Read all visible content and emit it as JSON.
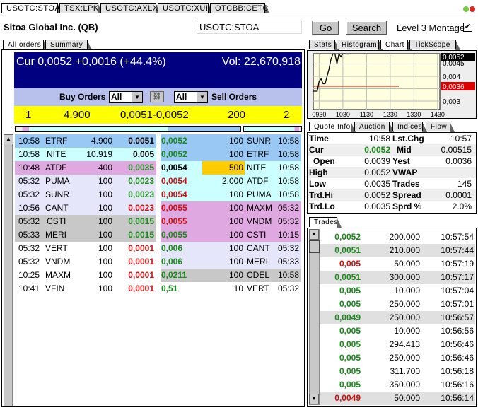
{
  "tabs": [
    "USOTC:STOA",
    "TSX:LPK",
    "USOTC:AXLX",
    "USOTC:XUII",
    "OTCBB:CETC"
  ],
  "company": "Sitoa Global Inc. (QB)",
  "symbol_input": "USOTC:STOA",
  "go_label": "Go",
  "search_label": "Search",
  "level3_label": "Level 3 Montage",
  "level3_checked": true,
  "left_tabs": [
    "All orders",
    "Summary"
  ],
  "summary": {
    "cur": "Cur 0,0052 +0,0016 (+44.4%)",
    "vol": "Vol: 22,670,918"
  },
  "filters": {
    "buy_label": "Buy Orders",
    "buy_value": "All",
    "sell_value": "All",
    "sell_label": "Sell Orders"
  },
  "inside": {
    "bid_count": "1",
    "bid_size": "4.900",
    "spread": "0,0051-0,0052",
    "ask_size": "200",
    "ask_count": "2"
  },
  "bids": [
    {
      "time": "10:58",
      "mm": "ETRF",
      "size": "4.900",
      "price": "0,0051",
      "c": "k",
      "bg": "#99c8f4"
    },
    {
      "time": "10:58",
      "mm": "NITE",
      "size": "10.919",
      "price": "0,005",
      "c": "k",
      "bg": "#ccffff"
    },
    {
      "time": "10:48",
      "mm": "ATDF",
      "size": "400",
      "price": "0,0035",
      "c": "g",
      "bg": "#e0a8e0"
    },
    {
      "time": "05:32",
      "mm": "PUMA",
      "size": "100",
      "price": "0,0023",
      "c": "g",
      "bg": "#e6e6fa"
    },
    {
      "time": "05:32",
      "mm": "SUNR",
      "size": "100",
      "price": "0,0023",
      "c": "g",
      "bg": "#e6e6fa"
    },
    {
      "time": "10:56",
      "mm": "CANT",
      "size": "100",
      "price": "0,0023",
      "c": "r",
      "bg": "#e6e6fa"
    },
    {
      "time": "05:32",
      "mm": "CSTI",
      "size": "100",
      "price": "0,0015",
      "c": "g",
      "bg": "#c8c8c8"
    },
    {
      "time": "05:33",
      "mm": "MERI",
      "size": "100",
      "price": "0,0015",
      "c": "g",
      "bg": "#c8c8c8"
    },
    {
      "time": "05:32",
      "mm": "VERT",
      "size": "100",
      "price": "0,0001",
      "c": "r",
      "bg": "#ffffff"
    },
    {
      "time": "05:32",
      "mm": "VNDM",
      "size": "100",
      "price": "0,0001",
      "c": "r",
      "bg": "#ffffff"
    },
    {
      "time": "10:25",
      "mm": "MAXM",
      "size": "100",
      "price": "0,0001",
      "c": "r",
      "bg": "#ffffff"
    },
    {
      "time": "10:41",
      "mm": "VFIN",
      "size": "100",
      "price": "0,0001",
      "c": "r",
      "bg": "#ffffff"
    }
  ],
  "asks": [
    {
      "price": "0,0052",
      "c": "g",
      "size": "100",
      "mm": "SUNR",
      "time": "10:58",
      "bg": "#99c8f4"
    },
    {
      "price": "0,0052",
      "c": "g",
      "size": "100",
      "mm": "ETRF",
      "time": "10:58",
      "bg": "#99c8f4"
    },
    {
      "price": "0,0054",
      "c": "k",
      "size": "500",
      "mm": "NITE",
      "time": "10:58",
      "bg": "#ccffff",
      "hl": "#ffcc00"
    },
    {
      "price": "0,0054",
      "c": "r",
      "size": "2.000",
      "mm": "ATDF",
      "time": "10:58",
      "bg": "#ccffff"
    },
    {
      "price": "0,0054",
      "c": "r",
      "size": "100",
      "mm": "PUMA",
      "time": "10:58",
      "bg": "#ccffff"
    },
    {
      "price": "0,0055",
      "c": "r",
      "size": "100",
      "mm": "MAXM",
      "time": "05:32",
      "bg": "#e0a8e0"
    },
    {
      "price": "0,0055",
      "c": "r",
      "size": "100",
      "mm": "VNDM",
      "time": "05:32",
      "bg": "#e0a8e0"
    },
    {
      "price": "0,0055",
      "c": "g",
      "size": "100",
      "mm": "CSTI",
      "time": "10:15",
      "bg": "#e0a8e0"
    },
    {
      "price": "0,006",
      "c": "g",
      "size": "100",
      "mm": "CANT",
      "time": "05:32",
      "bg": "#e6e6fa"
    },
    {
      "price": "0,006",
      "c": "g",
      "size": "100",
      "mm": "MERI",
      "time": "05:33",
      "bg": "#e6e6fa"
    },
    {
      "price": "0,0211",
      "c": "g",
      "size": "100",
      "mm": "CDEL",
      "time": "10:58",
      "bg": "#c8c8c8"
    },
    {
      "price": "0,51",
      "c": "g",
      "size": "10",
      "mm": "VERT",
      "time": "05:32",
      "bg": "#ffffff"
    }
  ],
  "right_tabs": [
    "Stats",
    "Histogram",
    "Chart",
    "TickScope"
  ],
  "chart_data": {
    "type": "line",
    "x_ticks": [
      "0930",
      "1030",
      "1130",
      "1230",
      "1330",
      "1430"
    ],
    "y_ticks": [
      "0,0045",
      "0,004",
      "0,003"
    ],
    "last_label": "0,0052",
    "ref_label": "0,0036",
    "ref_value": 0.0036,
    "series": [
      {
        "x": [
          "0915",
          "0925",
          "0930",
          "0935",
          "0940",
          "0945",
          "0950",
          "0955",
          "1000",
          "1005",
          "1010",
          "1015",
          "1020",
          "1025",
          "1030",
          "1035",
          "1040",
          "1045",
          "1050"
        ],
        "y": [
          0.0034,
          0.0034,
          0.0038,
          0.0039,
          0.0037,
          0.0037,
          0.004,
          0.0043,
          0.0047,
          0.0052,
          0.005,
          0.0045,
          0.0049,
          0.0048,
          0.0054,
          0.0053,
          0.0049,
          0.0049,
          0.0052
        ]
      }
    ],
    "colors": {
      "line": "#000000",
      "ref": "#dd0000",
      "bg": "#ffffe0"
    }
  },
  "quote_tabs": [
    "Quote Info",
    "Auction",
    "Indices",
    "Flow"
  ],
  "quote": [
    {
      "l1": "Time",
      "v1": "10:58",
      "l2": "Lst.Chg",
      "v2": "10:57"
    },
    {
      "l1": "Cur",
      "v1": "0.0052",
      "l2": "Mid",
      "v2": "0.00515"
    },
    {
      "l1": "Open",
      "v1": "0.0039",
      "l2": "Yest",
      "v2": "0.0036"
    },
    {
      "l1": "High",
      "v1": "0.0052",
      "l2": "VWAP",
      "v2": ""
    },
    {
      "l1": "Low",
      "v1": "0.0035",
      "l2": "Trades",
      "v2": "145"
    },
    {
      "l1": "Trd.Hi",
      "v1": "0.0052",
      "l2": "Spread",
      "v2": "0.0001"
    },
    {
      "l1": "Trd.Lo",
      "v1": "0.0035",
      "l2": "Sprd %",
      "v2": "2.0%"
    }
  ],
  "trades_tab": "Trades",
  "trades": [
    {
      "price": "0,0052",
      "c": "g",
      "size": "200.000",
      "time": "10:57:54",
      "shade": false
    },
    {
      "price": "0,0051",
      "c": "g",
      "size": "210.000",
      "time": "10:57:44",
      "shade": true
    },
    {
      "price": "0,005",
      "c": "r",
      "size": "50.000",
      "time": "10:57:19",
      "shade": false
    },
    {
      "price": "0,0051",
      "c": "g",
      "size": "300.000",
      "time": "10:57:17",
      "shade": true
    },
    {
      "price": "0,005",
      "c": "g",
      "size": "10.000",
      "time": "10:57:04",
      "shade": false
    },
    {
      "price": "0,005",
      "c": "g",
      "size": "250.000",
      "time": "10:57:01",
      "shade": false
    },
    {
      "price": "0,0049",
      "c": "g",
      "size": "250.000",
      "time": "10:56:57",
      "shade": true
    },
    {
      "price": "0,005",
      "c": "g",
      "size": "10.000",
      "time": "10:56:56",
      "shade": false
    },
    {
      "price": "0,005",
      "c": "g",
      "size": "294.413",
      "time": "10:56:46",
      "shade": false
    },
    {
      "price": "0,005",
      "c": "g",
      "size": "250.000",
      "time": "10:56:46",
      "shade": false
    },
    {
      "price": "0,005",
      "c": "g",
      "size": "311.700",
      "time": "10:56:18",
      "shade": false
    },
    {
      "price": "0,005",
      "c": "g",
      "size": "350.000",
      "time": "10:56:16",
      "shade": false
    },
    {
      "price": "0,0049",
      "c": "r",
      "size": "50.000",
      "time": "10:56:14",
      "shade": true
    }
  ]
}
